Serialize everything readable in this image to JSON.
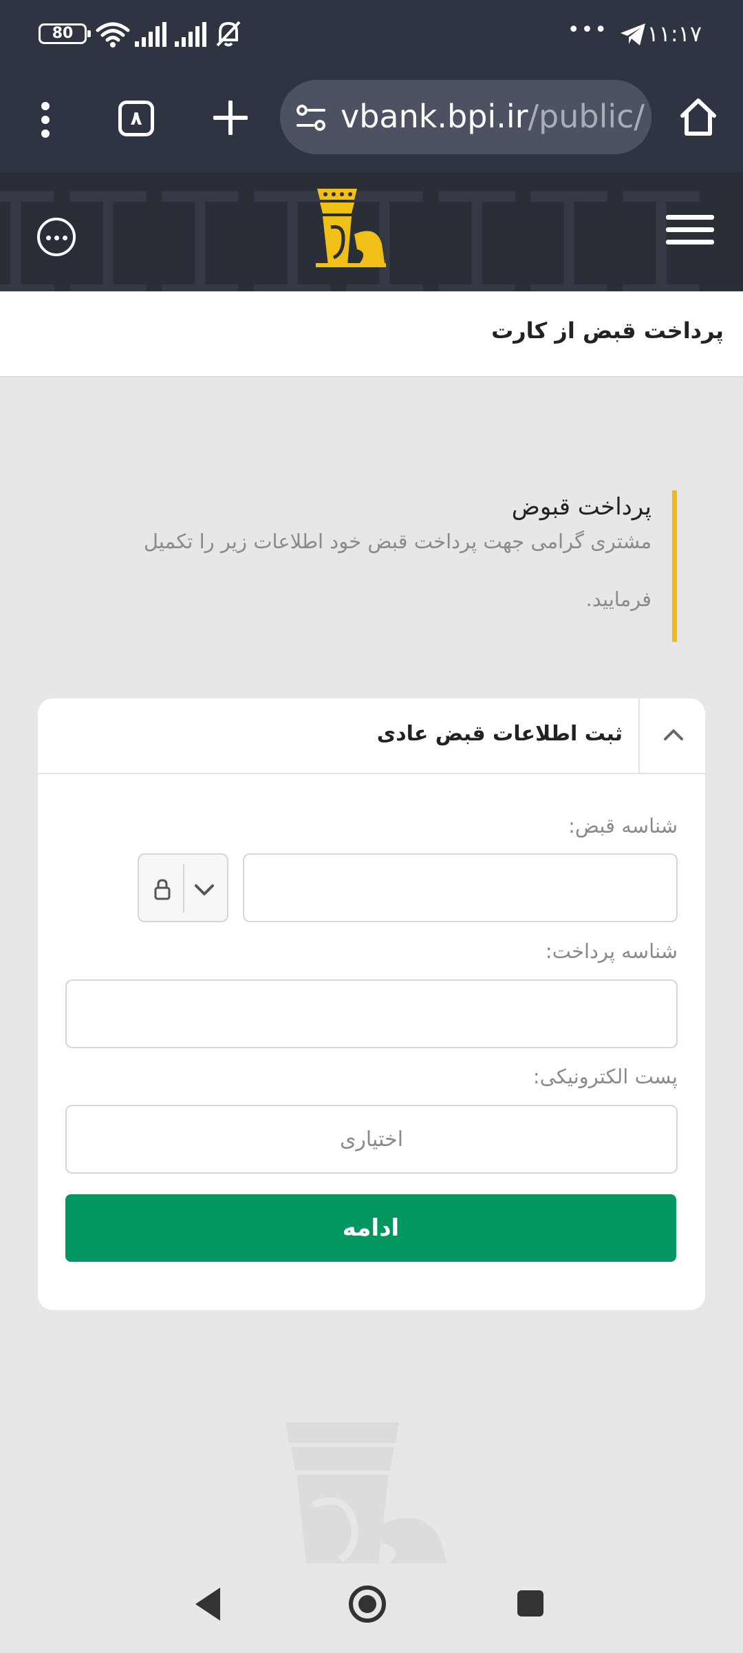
{
  "status_bar": {
    "time": "۱۱:۱۷",
    "battery": "80",
    "more": "•••"
  },
  "browser": {
    "url_host": "vbank.bpi.ir",
    "url_path": "/public/",
    "tabs_count": "۸"
  },
  "page": {
    "title": "پرداخت قبض از کارت"
  },
  "info": {
    "heading": "پرداخت قبوض",
    "description": "مشتری گرامی جهت پرداخت قبض خود اطلاعات زیر را تکمیل فرمایید."
  },
  "form": {
    "card_title": "ثبت اطلاعات قبض عادی",
    "bill_id_label": "شناسه قبض:",
    "bill_id_value": "",
    "payment_id_label": "شناسه پرداخت:",
    "payment_id_value": "",
    "email_label": "پست الکترونیکی:",
    "email_placeholder": "اختیاری",
    "continue_label": "ادامه"
  },
  "colors": {
    "accent_yellow": "#f0b914",
    "primary_green": "#029660",
    "header_dark": "#2f3442"
  }
}
